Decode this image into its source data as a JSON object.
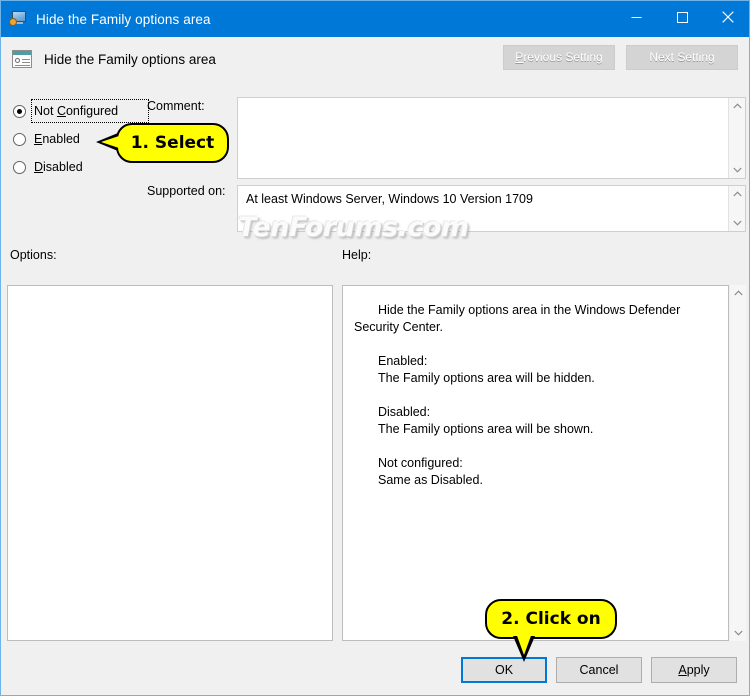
{
  "window": {
    "title": "Hide the Family options area",
    "icon": "policy-setting-icon",
    "controls": {
      "minimize": "Minimize",
      "maximize": "Maximize",
      "close": "Close"
    }
  },
  "header": {
    "title": "Hide the Family options area",
    "icon": "gpedit-setting-icon",
    "previous_setting": "Previous Setting",
    "next_setting": "Next Setting"
  },
  "state": {
    "options": [
      {
        "label": "Not Configured",
        "accel": "C",
        "selected": true,
        "focused": true
      },
      {
        "label": "Enabled",
        "accel": "E",
        "selected": false,
        "focused": false
      },
      {
        "label": "Disabled",
        "accel": "D",
        "selected": false,
        "focused": false
      }
    ]
  },
  "fields": {
    "comment_label": "Comment:",
    "comment_value": "",
    "comment_placeholder": "",
    "supported_label": "Supported on:",
    "supported_value": "At least Windows Server, Windows 10 Version 1709"
  },
  "panels": {
    "options_label": "Options:",
    "options_content": "",
    "help_label": "Help:",
    "help": {
      "intro": "Hide the Family options area in the Windows Defender Security Center.",
      "enabled_heading": "Enabled:",
      "enabled_body": "The Family options area will be hidden.",
      "disabled_heading": "Disabled:",
      "disabled_body": "The Family options area will be shown.",
      "notconfigured_heading": "Not configured:",
      "notconfigured_body": "Same as Disabled."
    }
  },
  "buttons": {
    "ok": "OK",
    "cancel": "Cancel",
    "apply": "Apply",
    "apply_accel": "A"
  },
  "annotations": {
    "callout_1": "1. Select",
    "callout_2": "2. Click on"
  },
  "watermark": "TenForums.com",
  "colors": {
    "titlebar": "#0078d7",
    "accent": "#0078d7",
    "callout_fill": "#ffff00",
    "dialog_bg": "#f0f0f0"
  }
}
